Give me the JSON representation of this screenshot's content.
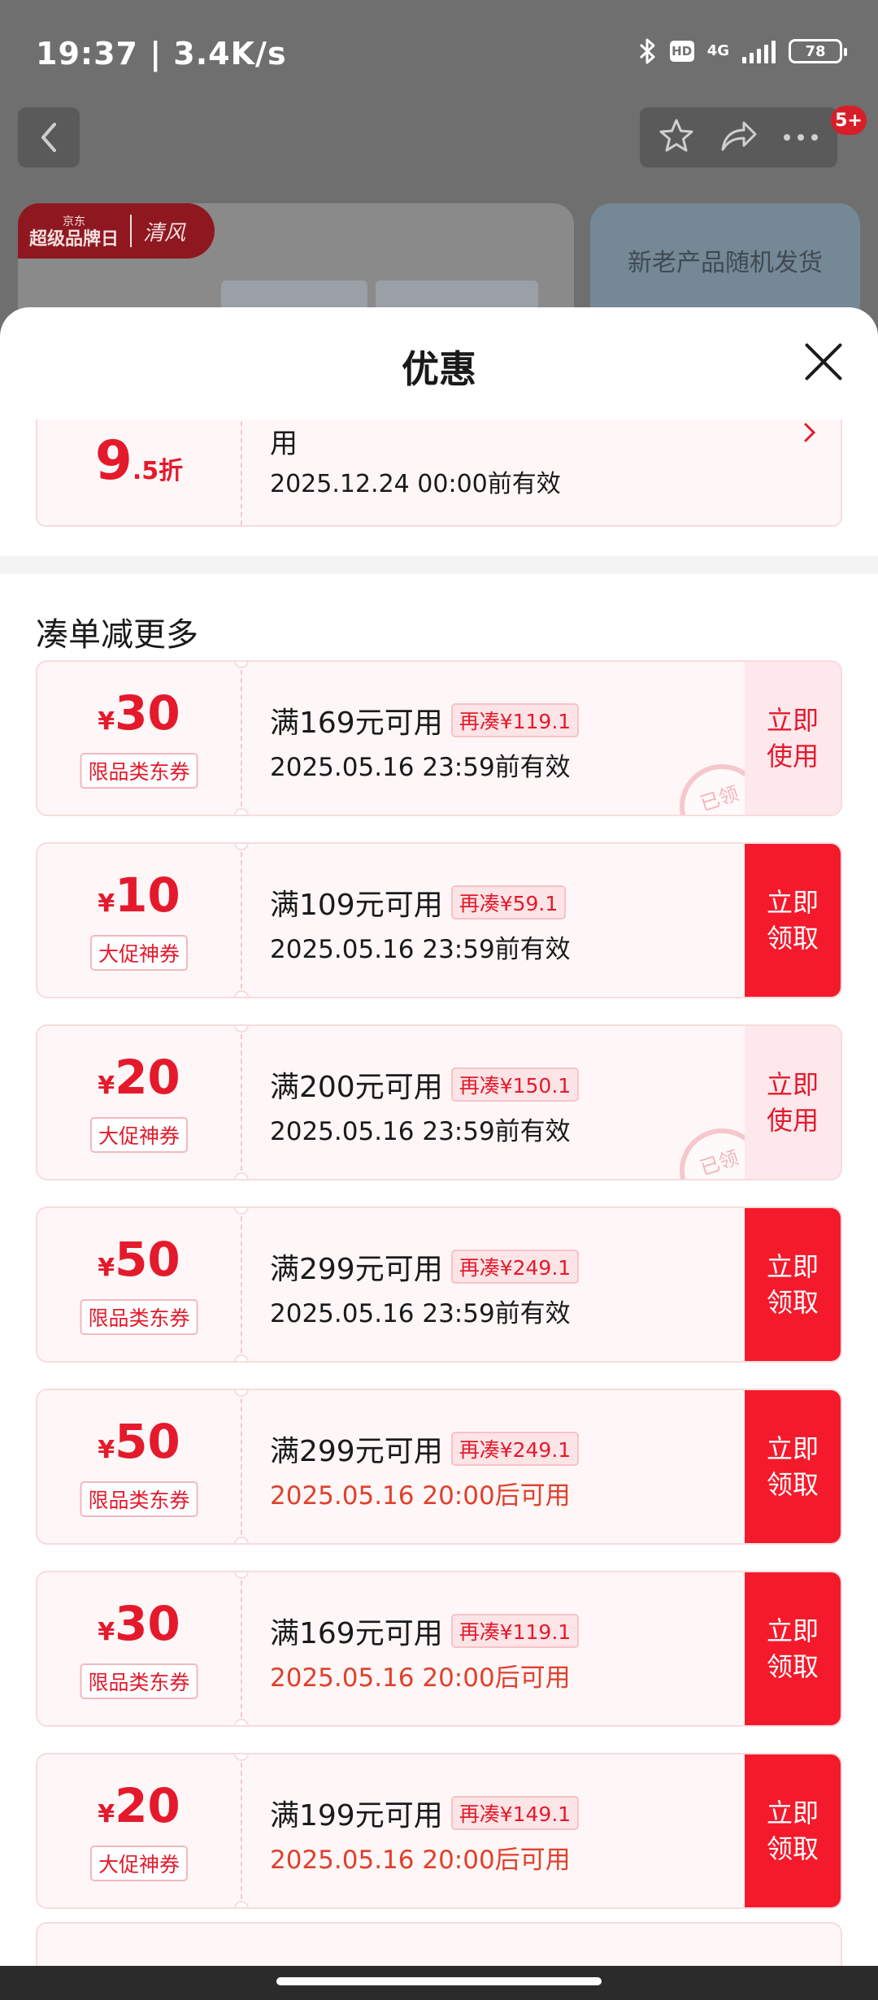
{
  "status_bar": {
    "time": "19:37 | 3.4K/s",
    "hd": "HD",
    "network": "4G",
    "battery": "78"
  },
  "top_bar": {
    "cart_badge": "5+"
  },
  "background_page": {
    "brand_name": "京东",
    "brand_event": "超级品牌日",
    "brand_logo": "清风",
    "new_product_note": "新老产品随机发货"
  },
  "sheet": {
    "title": "优惠",
    "top_coupon": {
      "discount_number": "9",
      "discount_suffix": ".5折",
      "line1": "用",
      "validity": "2025.12.24 00:00前有效"
    },
    "section_title": "凑单减更多",
    "coupons": [
      {
        "currency": "¥",
        "amount": "30",
        "tag": "限品类东券",
        "condition": "满169元可用",
        "more": "再凑¥119.1",
        "validity": "2025.05.16 23:59前有效",
        "validity_style": "normal",
        "action_line1": "立即",
        "action_line2": "使用",
        "action_style": "use",
        "stamp": "已领"
      },
      {
        "currency": "¥",
        "amount": "10",
        "tag": "大促神券",
        "condition": "满109元可用",
        "more": "再凑¥59.1",
        "validity": "2025.05.16 23:59前有效",
        "validity_style": "normal",
        "action_line1": "立即",
        "action_line2": "领取",
        "action_style": "claim",
        "stamp": ""
      },
      {
        "currency": "¥",
        "amount": "20",
        "tag": "大促神券",
        "condition": "满200元可用",
        "more": "再凑¥150.1",
        "validity": "2025.05.16 23:59前有效",
        "validity_style": "normal",
        "action_line1": "立即",
        "action_line2": "使用",
        "action_style": "use",
        "stamp": "已领"
      },
      {
        "currency": "¥",
        "amount": "50",
        "tag": "限品类东券",
        "condition": "满299元可用",
        "more": "再凑¥249.1",
        "validity": "2025.05.16 23:59前有效",
        "validity_style": "normal",
        "action_line1": "立即",
        "action_line2": "领取",
        "action_style": "claim",
        "stamp": ""
      },
      {
        "currency": "¥",
        "amount": "50",
        "tag": "限品类东券",
        "condition": "满299元可用",
        "more": "再凑¥249.1",
        "validity": "2025.05.16 20:00后可用",
        "validity_style": "red",
        "action_line1": "立即",
        "action_line2": "领取",
        "action_style": "claim",
        "stamp": ""
      },
      {
        "currency": "¥",
        "amount": "30",
        "tag": "限品类东券",
        "condition": "满169元可用",
        "more": "再凑¥119.1",
        "validity": "2025.05.16 20:00后可用",
        "validity_style": "red",
        "action_line1": "立即",
        "action_line2": "领取",
        "action_style": "claim",
        "stamp": ""
      },
      {
        "currency": "¥",
        "amount": "20",
        "tag": "大促神券",
        "condition": "满199元可用",
        "more": "再凑¥149.1",
        "validity": "2025.05.16 20:00后可用",
        "validity_style": "red",
        "action_line1": "立即",
        "action_line2": "领取",
        "action_style": "claim",
        "stamp": ""
      }
    ]
  },
  "colors": {
    "accent": "#f41a2c",
    "price_red": "#e41a2c",
    "coupon_bg": "#fff7f7"
  }
}
